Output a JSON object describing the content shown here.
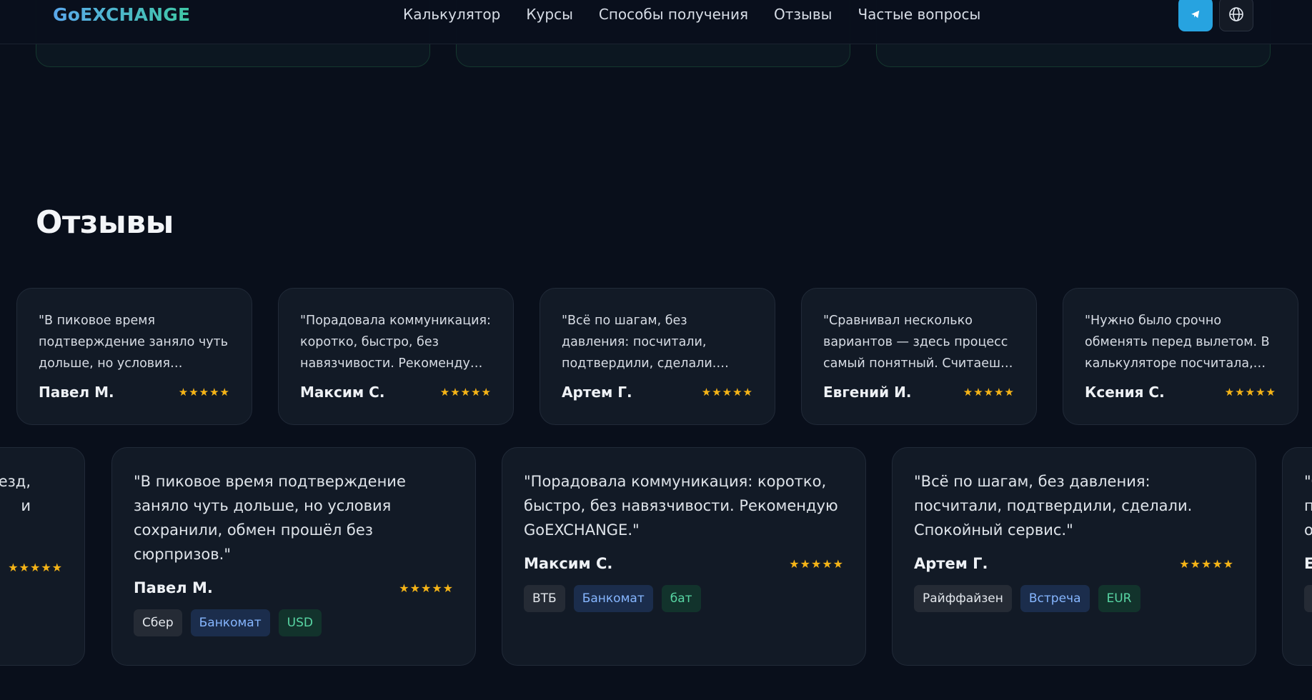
{
  "header": {
    "logo": "GoEXCHANGE",
    "nav": [
      "Калькулятор",
      "Курсы",
      "Способы получения",
      "Отзывы",
      "Частые вопросы"
    ],
    "telegram_icon": "telegram-icon",
    "language_icon": "globe-icon"
  },
  "reviews": {
    "title": "Отзывы",
    "small": [
      {
        "text": "\"В пиковое время подтверждение заняло чуть дольше, но условия сохранили, обмен прошёл без сюрпризов.\"",
        "name": "Павел М.",
        "stars": "★★★★★"
      },
      {
        "text": "\"Порадовала коммуникация: коротко, быстро, без навязчивости. Рекомендую GoEXCHANGE.\"",
        "name": "Максим С.",
        "stars": "★★★★★"
      },
      {
        "text": "\"Всё по шагам, без давления: посчитали, подтвердили, сделали. Спокойный сервис.\"",
        "name": "Артем Г.",
        "stars": "★★★★★"
      },
      {
        "text": "\"Сравнивал несколько вариантов — здесь процесс самый понятный. Считаешь, подтверждаешь, получаешь.\"",
        "name": "Евгений И.",
        "stars": "★★★★★"
      },
      {
        "text": "\"Нужно было срочно обменять перед вылетом. В калькуляторе посчитала, подтвердили быстро.\"",
        "name": "Ксения С.",
        "stars": "★★★★★"
      }
    ],
    "big": [
      {
        "text": "\"В пиковое время подтверждение заняло чуть дольше, но условия сохранили, обмен прошёл без сюрпризов.\"",
        "name": "Павел М.",
        "stars": "★★★★★",
        "tags": {
          "bank": "Сбер",
          "method": "Банкомат",
          "currency": "USD"
        }
      },
      {
        "text": "\"Порадовала коммуникация: коротко, быстро, без навязчивости. Рекомендую GoEXCHANGE.\"",
        "name": "Максим С.",
        "stars": "★★★★★",
        "tags": {
          "bank": "ВТБ",
          "method": "Банкомат",
          "currency": "бат"
        }
      },
      {
        "text": "\"Всё по шагам, без давления: посчитали, подтвердили, сделали. Спокойный сервис.\"",
        "name": "Артем Г.",
        "stars": "★★★★★",
        "tags": {
          "bank": "Райффайзен",
          "method": "Встреча",
          "currency": "EUR"
        }
      }
    ],
    "partial_left": {
      "line1": "езд,",
      "line2": "и",
      "stars": "★★★★★"
    },
    "partial_right": {
      "line1": "\"С",
      "line2": "п",
      "line3": "о",
      "name": "Е"
    }
  },
  "colors": {
    "background": "#090f1b",
    "card": "#121a26",
    "accent_blue": "#27a3e0",
    "star": "#f5b417"
  }
}
